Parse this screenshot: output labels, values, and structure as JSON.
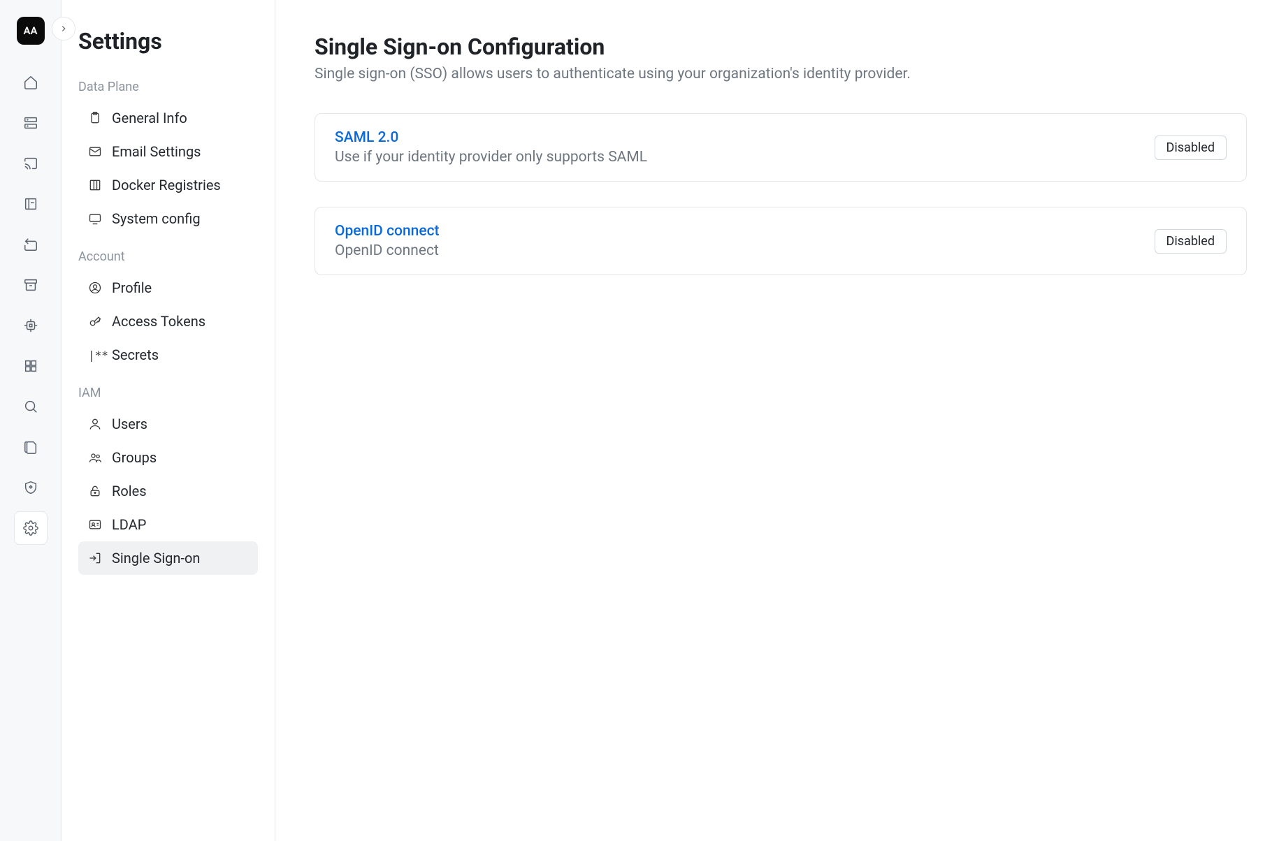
{
  "avatar_initials": "AA",
  "sidebar": {
    "title": "Settings",
    "sections": [
      {
        "title": "Data Plane",
        "items": [
          {
            "label": "General Info"
          },
          {
            "label": "Email Settings"
          },
          {
            "label": "Docker Registries"
          },
          {
            "label": "System config"
          }
        ]
      },
      {
        "title": "Account",
        "items": [
          {
            "label": "Profile"
          },
          {
            "label": "Access Tokens"
          },
          {
            "label": "Secrets"
          }
        ]
      },
      {
        "title": "IAM",
        "items": [
          {
            "label": "Users"
          },
          {
            "label": "Groups"
          },
          {
            "label": "Roles"
          },
          {
            "label": "LDAP"
          },
          {
            "label": "Single Sign-on"
          }
        ]
      }
    ]
  },
  "main": {
    "title": "Single Sign-on Configuration",
    "subtitle": "Single sign-on (SSO) allows users to authenticate using your organization's identity provider.",
    "cards": [
      {
        "title": "SAML 2.0",
        "desc": "Use if your identity provider only supports SAML",
        "status": "Disabled"
      },
      {
        "title": "OpenID connect",
        "desc": "OpenID connect",
        "status": "Disabled"
      }
    ]
  }
}
